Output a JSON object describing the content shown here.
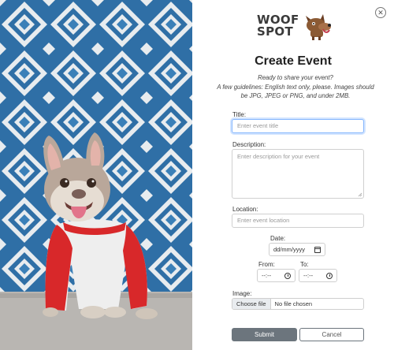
{
  "brand": {
    "line1": "WOOF",
    "line2": "SPOT"
  },
  "close_symbol": "✕",
  "page_title": "Create Event",
  "intro": {
    "line1": "Ready to share your event?",
    "line2": "A few guidelines: English text only, please. Images should",
    "line3": "be JPG, JPEG or PNG, and under 2MB."
  },
  "form": {
    "title_label": "Title:",
    "title_placeholder": "Enter event title",
    "description_label": "Description:",
    "description_placeholder": "Enter description for your event",
    "location_label": "Location:",
    "location_placeholder": "Enter event location",
    "date_label": "Date:",
    "date_value": "dd/mm/yyyy",
    "from_label": "From:",
    "from_value": "--:--",
    "to_label": "To:",
    "to_value": "--:--",
    "image_label": "Image:",
    "file_button": "Choose file",
    "file_status": "No file chosen"
  },
  "buttons": {
    "submit": "Submit",
    "cancel": "Cancel"
  },
  "colors": {
    "tile_blue": "#2f6fa6",
    "tile_white": "#e8ecef",
    "dog_shirt_red": "#d8282a",
    "submit_gray": "#6c757d"
  }
}
